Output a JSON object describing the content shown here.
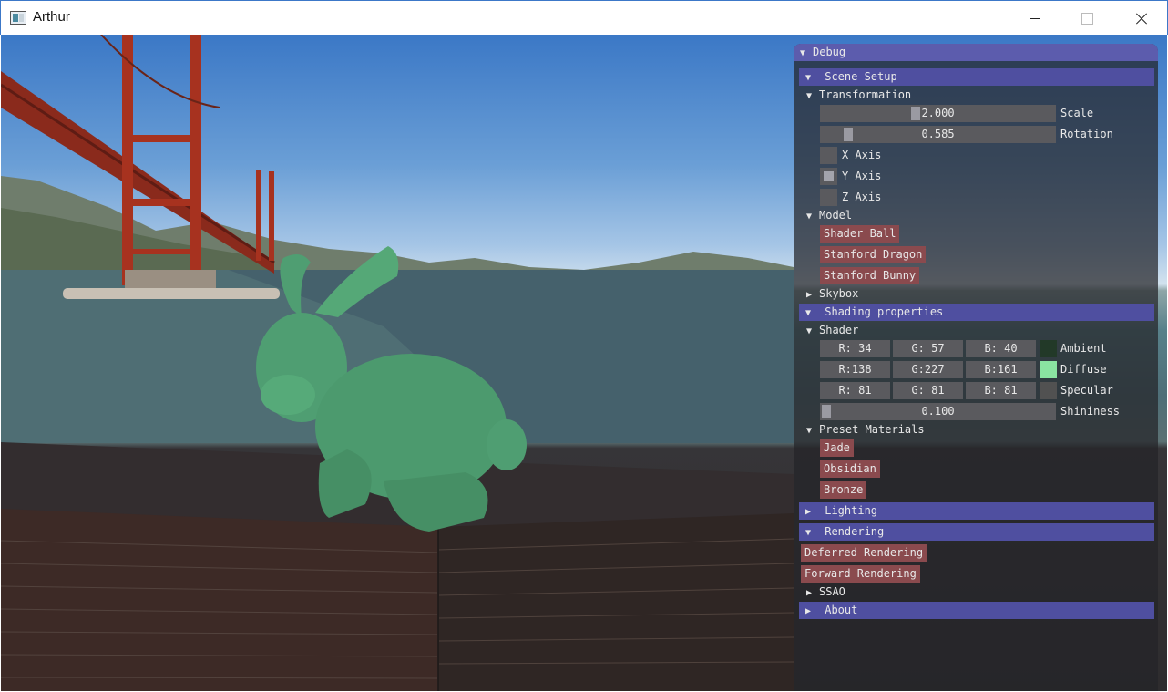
{
  "window": {
    "title": "Arthur",
    "icon": "app-window-icon"
  },
  "debug": {
    "title": "Debug",
    "scene_setup": {
      "label": "Scene Setup",
      "transformation": {
        "label": "Transformation",
        "scale": {
          "value": "2.000",
          "label": "Scale",
          "fraction": 0.5
        },
        "rotation": {
          "value": "0.585",
          "label": "Rotation",
          "fraction": 0.093
        },
        "x_axis": {
          "label": "X Axis",
          "checked": false
        },
        "y_axis": {
          "label": "Y Axis",
          "checked": true
        },
        "z_axis": {
          "label": "Z Axis",
          "checked": false
        }
      },
      "model": {
        "label": "Model",
        "buttons": [
          "Shader Ball",
          "Stanford Dragon",
          "Stanford Bunny"
        ]
      },
      "skybox": {
        "label": "Skybox"
      }
    },
    "shading": {
      "label": "Shading properties",
      "shader": {
        "label": "Shader",
        "ambient": {
          "r": "R: 34",
          "g": "G: 57",
          "b": "B: 40",
          "label": "Ambient",
          "color": "#223928"
        },
        "diffuse": {
          "r": "R:138",
          "g": "G:227",
          "b": "B:161",
          "label": "Diffuse",
          "color": "#8ae3a1"
        },
        "specular": {
          "r": "R: 81",
          "g": "G: 81",
          "b": "B: 81",
          "label": "Specular",
          "color": "#515151"
        },
        "shininess": {
          "value": "0.100",
          "label": "Shininess",
          "fraction": 0.0
        }
      },
      "presets": {
        "label": "Preset Materials",
        "buttons": [
          "Jade",
          "Obsidian",
          "Bronze"
        ]
      }
    },
    "lighting": {
      "label": "Lighting"
    },
    "rendering": {
      "label": "Rendering",
      "buttons": [
        "Deferred Rendering",
        "Forward Rendering"
      ],
      "ssao": {
        "label": "SSAO"
      }
    },
    "about": {
      "label": "About"
    }
  },
  "colors": {
    "header": "#4f4fa0",
    "title": "#5c5cad",
    "button": "#8a4a4e",
    "bunny": "#4f9e72"
  }
}
